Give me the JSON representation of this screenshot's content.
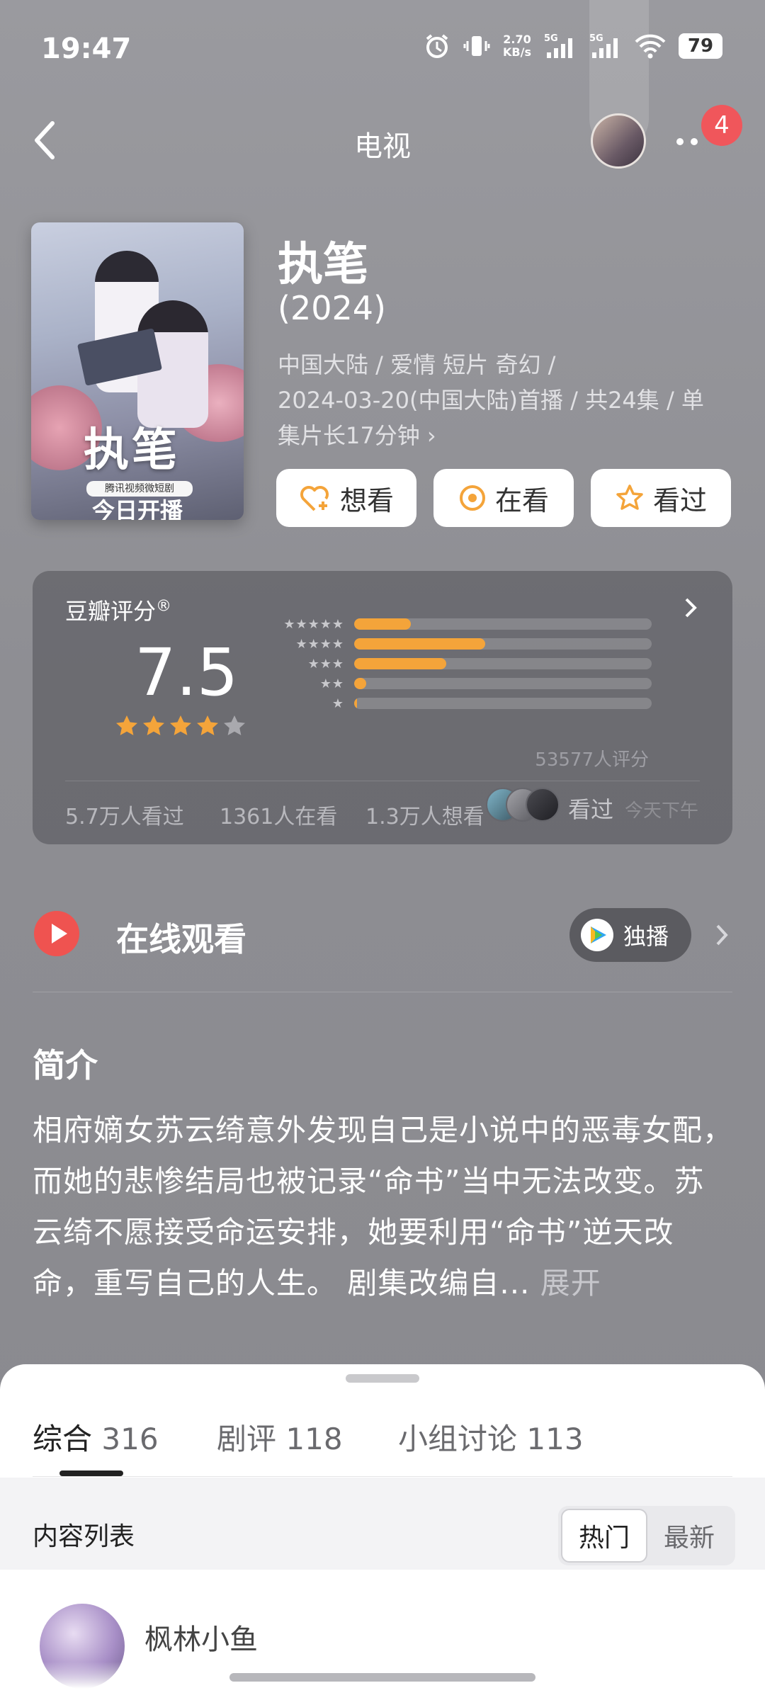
{
  "status_bar": {
    "time": "19:47",
    "net_speed_value": "2.70",
    "net_speed_unit": "KB/s",
    "signal1_label": "5G",
    "signal2_label": "5G",
    "battery": "79"
  },
  "nav": {
    "title": "电视",
    "notification_count": "4"
  },
  "show": {
    "title": "执笔",
    "year": "(2024)",
    "meta_line1": "中国大陆 / 爱情 短片 奇幻 /",
    "meta_line2": "2024-03-20(中国大陆)首播 / 共24集 / 单",
    "meta_line3": "集片长17分钟",
    "poster": {
      "calligraphy": "执笔",
      "badge": "腾讯视频微短剧",
      "bottom": "今日开播"
    }
  },
  "actions": {
    "want": "想看",
    "watching": "在看",
    "watched": "看过"
  },
  "rating": {
    "label": "豆瓣评分",
    "registered": "®",
    "score": "7.5",
    "stars_filled": 4,
    "distribution": [
      {
        "stars": "★★★★★",
        "fraction": 0.19
      },
      {
        "stars": "★★★★",
        "fraction": 0.44
      },
      {
        "stars": "★★★",
        "fraction": 0.31
      },
      {
        "stars": "★★",
        "fraction": 0.04
      },
      {
        "stars": "★",
        "fraction": 0.01
      }
    ],
    "count": "53577人评分",
    "watched_count": "5.7万人看过",
    "watching_count": "1361人在看",
    "want_count": "1.3万人想看",
    "seen_label": "看过",
    "seen_time": "今天下午"
  },
  "online": {
    "title": "在线观看",
    "exclusive": "独播"
  },
  "synopsis": {
    "title": "简介",
    "text": "相府嫡女苏云绮意外发现自己是小说中的恶毒女配，而她的悲惨结局也被记录“命书”当中无法改变。苏云绮不愿接受命运安排，她要利用“命书”逆天改命，重写自己的人生。 剧集改编自...",
    "expand": "展开"
  },
  "tabs": [
    {
      "label": "综合",
      "count": "316"
    },
    {
      "label": "剧评",
      "count": "118"
    },
    {
      "label": "小组讨论",
      "count": "113"
    }
  ],
  "content_list": {
    "title": "内容列表",
    "sort_hot": "热门",
    "sort_new": "最新"
  },
  "first_item": {
    "user": "枫林小鱼"
  },
  "colors": {
    "accent_orange": "#f4a43a",
    "play_red": "#ef5350",
    "badge_red": "#f0565b"
  }
}
